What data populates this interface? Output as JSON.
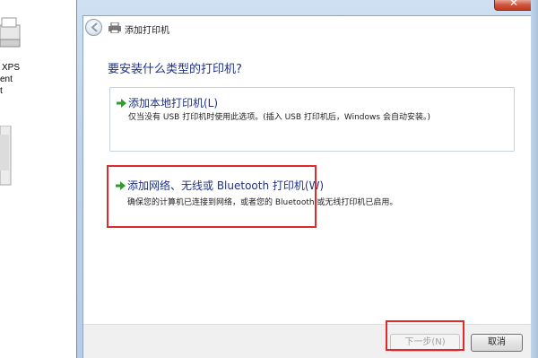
{
  "background": {
    "label_line1": "XPS",
    "label_line2": "ent",
    "label_line3": "t"
  },
  "dialog": {
    "title": "添加打印机",
    "close_label": "✕",
    "question": "要安装什么类型的打印机?",
    "options": [
      {
        "title": "添加本地打印机(L)",
        "description": "仅当没有 USB 打印机时使用此选项。(插入 USB 打印机后，Windows 会自动安装。)"
      },
      {
        "title": "添加网络、无线或 Bluetooth 打印机(W)",
        "description": "确保您的计算机已连接到网络，或者您的 Bluetooth 或无线打印机已启用。"
      }
    ],
    "buttons": {
      "next": "下一步(N)",
      "cancel": "取消"
    },
    "next_enabled": false
  },
  "colors": {
    "link_blue": "#1e3287",
    "annotation_red": "#e02a2a",
    "arrow_green": "#2f9e2f"
  },
  "icons": {
    "back": "back-arrow-icon",
    "printer": "printer-icon",
    "option_arrow": "green-arrow-icon"
  }
}
